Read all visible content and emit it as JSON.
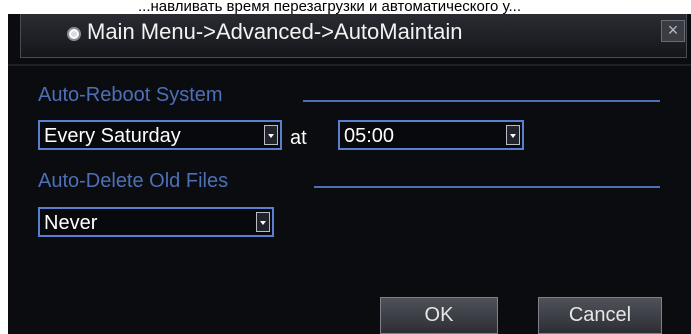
{
  "top_caption": "...навливать время перезагрузки и автоматического у...",
  "window": {
    "title": "Main Menu->Advanced->AutoMaintain",
    "close_label": "×"
  },
  "auto_reboot": {
    "label": "Auto-Reboot System",
    "day_value": "Every Saturday",
    "at_label": "at",
    "time_value": "05:00"
  },
  "auto_delete": {
    "label": "Auto-Delete Old Files",
    "value": "Never"
  },
  "buttons": {
    "ok": "OK",
    "cancel": "Cancel"
  },
  "colors": {
    "background": "#0b0c10",
    "accent": "#4d6fb8",
    "combo_border": "#5b7fd0"
  }
}
